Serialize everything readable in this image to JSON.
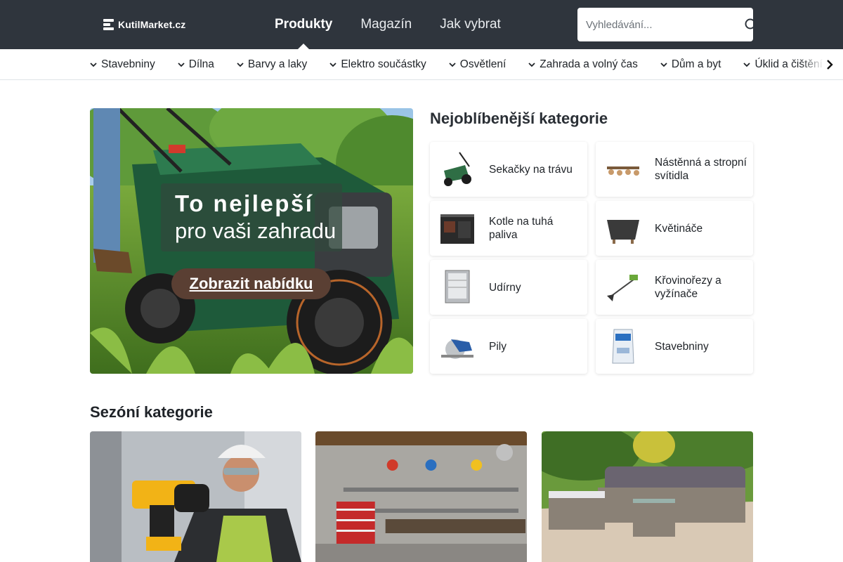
{
  "header": {
    "logo_text": "KutilMarket.cz",
    "nav": [
      {
        "label": "Produkty",
        "active": true
      },
      {
        "label": "Magazín",
        "active": false
      },
      {
        "label": "Jak vybrat",
        "active": false
      }
    ],
    "search_placeholder": "Vyhledávání...",
    "search_icon": "search-icon"
  },
  "category_bar": {
    "items": [
      "Stavebniny",
      "Dílna",
      "Barvy a laky",
      "Elektro součástky",
      "Osvětlení",
      "Zahrada a volný čas",
      "Dům a byt",
      "Úklid a čištění"
    ],
    "next_icon": "chevron-right-icon"
  },
  "hero": {
    "title": "To nejlepší",
    "subtitle": "pro vaši zahradu",
    "button_label": "Zobrazit nabídku"
  },
  "popular": {
    "title": "Nejoblíbenější kategorie",
    "items": [
      {
        "label": "Sekačky na trávu",
        "icon": "lawnmower-icon"
      },
      {
        "label": "Nástěnná a stropní svítidla",
        "icon": "ceiling-light-icon"
      },
      {
        "label": "Kotle na tuhá paliva",
        "icon": "stove-icon"
      },
      {
        "label": "Květináče",
        "icon": "planter-icon"
      },
      {
        "label": "Udírny",
        "icon": "smoker-icon"
      },
      {
        "label": "Křovinořezy a vyžínače",
        "icon": "trimmer-icon"
      },
      {
        "label": "Pily",
        "icon": "circular-saw-icon"
      },
      {
        "label": "Stavebniny",
        "icon": "cement-bag-icon"
      }
    ]
  },
  "seasonal": {
    "title": "Sezóní kategorie",
    "cards": [
      {
        "image": "worker-with-drill-photo"
      },
      {
        "image": "workshop-photo"
      },
      {
        "image": "garden-furniture-photo"
      }
    ]
  },
  "colors": {
    "header_bg": "#2f353d",
    "hero_button": "#5a3f33",
    "text": "#1f2328"
  }
}
